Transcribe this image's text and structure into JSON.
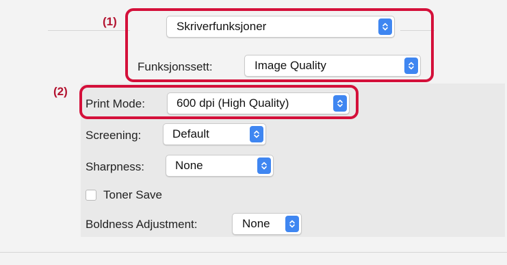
{
  "markers": {
    "one": "(1)",
    "two": "(2)"
  },
  "preset_select": {
    "value": "Skriverfunksjoner"
  },
  "feature_set": {
    "label": "Funksjonssett:",
    "value": "Image Quality"
  },
  "print_mode": {
    "label": "Print Mode:",
    "value": "600 dpi (High Quality)"
  },
  "screening": {
    "label": "Screening:",
    "value": "Default"
  },
  "sharpness": {
    "label": "Sharpness:",
    "value": "None"
  },
  "toner_save": {
    "label": "Toner Save",
    "checked": false
  },
  "boldness": {
    "label": "Boldness Adjustment:",
    "value": "None"
  },
  "colors": {
    "accent": "#3f86f1",
    "callout": "#d4103a",
    "marker_text": "#b3122f"
  },
  "icons": {
    "stepper": "up-down-chevron-icon"
  }
}
